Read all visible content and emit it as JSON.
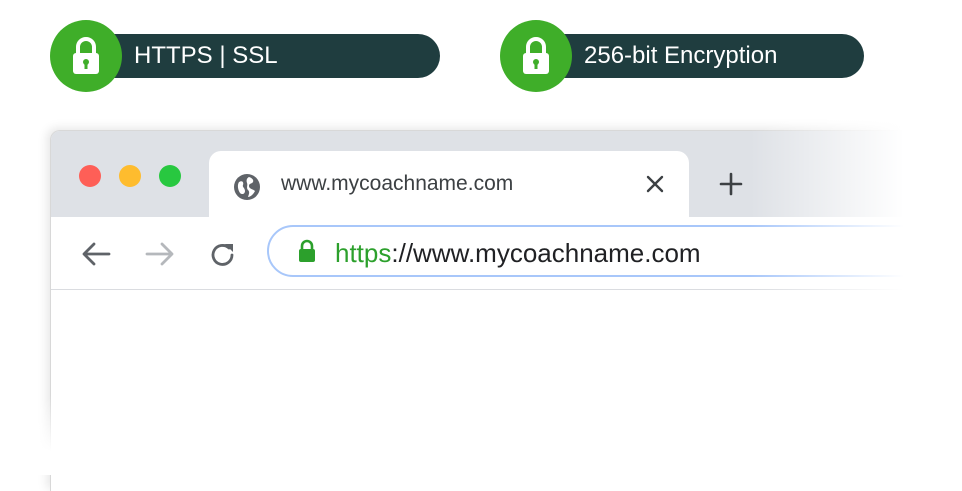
{
  "badges": [
    {
      "label": "HTTPS | SSL",
      "icon": "padlock-icon"
    },
    {
      "label": "256-bit Encryption",
      "icon": "padlock-icon"
    }
  ],
  "browser": {
    "tab": {
      "title": "www.mycoachname.com",
      "icon": "globe-icon"
    },
    "address": {
      "scheme": "https",
      "rest": "://www.mycoachname.com"
    }
  },
  "colors": {
    "badge_green": "#3fae29",
    "badge_dark": "#1f3d3f",
    "url_green": "#2ca02c",
    "tabbar": "#dee1e6"
  }
}
